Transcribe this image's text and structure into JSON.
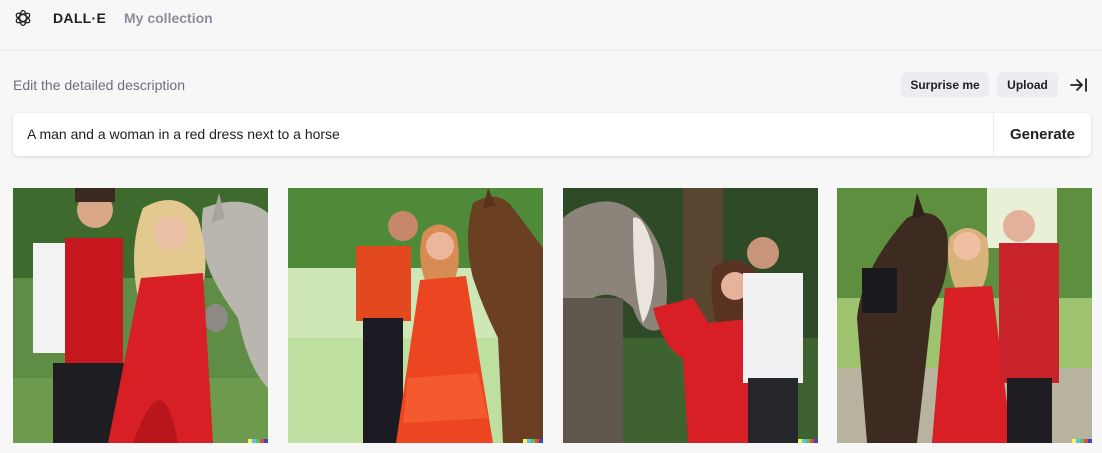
{
  "header": {
    "brand": "DALL·E",
    "nav_collection": "My collection",
    "logo_icon": "openai-logo-icon"
  },
  "editor": {
    "label": "Edit the detailed description",
    "surprise_label": "Surprise me",
    "upload_label": "Upload",
    "collapse_icon": "collapse-right-icon",
    "prompt_value": "A man and a woman in a red dress next to a horse",
    "generate_label": "Generate"
  },
  "results": {
    "images": [
      {
        "subject": "couple-red-dress-white-horse"
      },
      {
        "subject": "couple-orange-ruffled-dress-brown-horse"
      },
      {
        "subject": "couple-red-dress-grey-horse"
      },
      {
        "subject": "couple-red-dress-dark-horse"
      }
    ]
  },
  "colors": {
    "accent_red": "#d81f26",
    "pill_bg": "#ececf1",
    "muted_text": "#8e8ea0"
  }
}
